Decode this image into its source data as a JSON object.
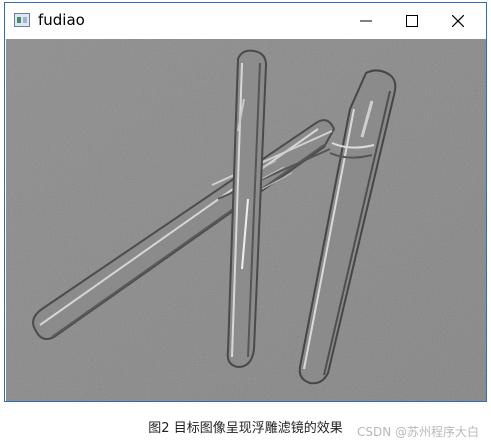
{
  "window": {
    "title": "fudiao",
    "icon": "app-window-icon",
    "controls": [
      "minimize-icon",
      "maximize-icon",
      "close-icon"
    ]
  },
  "canvas": {
    "description_icon": "embossed-pens-image"
  },
  "caption": {
    "text": "图2  目标图像呈现浮雕滤镜的效果"
  },
  "watermark": {
    "text": "CSDN @苏州程序大白"
  }
}
